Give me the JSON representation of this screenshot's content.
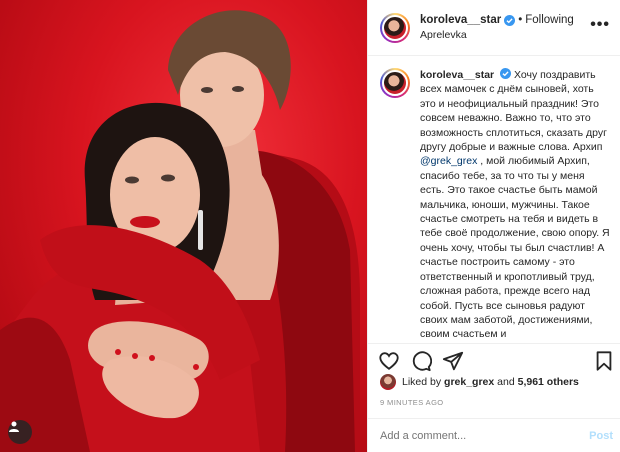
{
  "colors": {
    "accent": "#0095f6",
    "verified": "#3897f0",
    "photo_bg": "#d8141f",
    "link": "#00376b"
  },
  "header": {
    "username": "koroleva__star",
    "separator": "•",
    "follow_status": "Following",
    "location": "Aprelevka",
    "more": "•••"
  },
  "caption": {
    "username": "koroleva__star",
    "text_before": "Хочу поздравить всех мамочек с днём сыновей, хоть это и неофициальный праздник! Это совсем неважно. Важно то, что это возможность сплотиться, сказать друг другу добрые и важные слова. Архип ",
    "mention": "@grek_grex",
    "text_after": " , мой любимый Архип, спасибо тебе, за то что ты у меня есть. Это такое счастье быть мамой мальчика, юноши, мужчины. Такое счастье смотреть на тебя и видеть в тебе своё продолжение, свою опору. Я очень хочу, чтобы ты был счастлив! А счастье построить самому - это ответственный и кропотливый труд, сложная работа, прежде всего над собой. Пусть все сыновья радуют своих мам заботой, достижениями, своим счастьем и"
  },
  "likes": {
    "prefix": "Liked by",
    "user": "grek_grex",
    "and": "and",
    "count": "5,961 others"
  },
  "timestamp": "9 MINUTES AGO",
  "comment": {
    "placeholder": "Add a comment...",
    "post_label": "Post"
  },
  "icons": [
    "heart-icon",
    "comment-icon",
    "share-icon",
    "bookmark-icon",
    "user-tag-icon",
    "verified-icon"
  ]
}
